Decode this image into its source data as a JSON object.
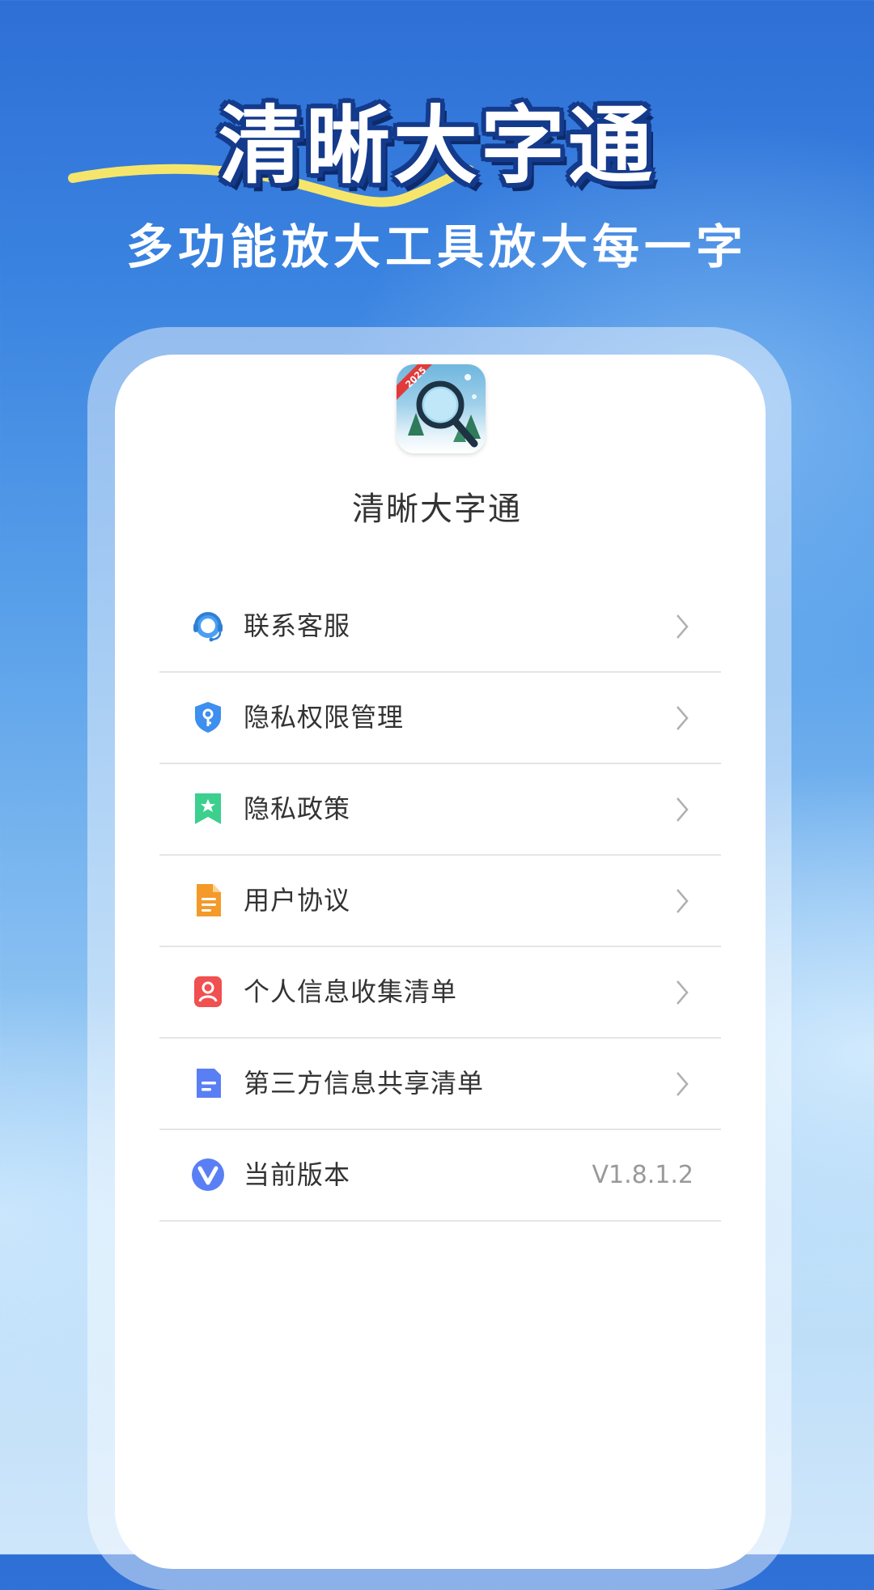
{
  "banner": {
    "title": "清晰大字通",
    "subtitle": "多功能放大工具放大每一字",
    "swoosh_color": "#f5e66b"
  },
  "app": {
    "icon_badge": "2025",
    "name": "清晰大字通"
  },
  "menu": {
    "items": [
      {
        "label": "联系客服",
        "icon": "headset-icon",
        "color": "#4a9ff0"
      },
      {
        "label": "隐私权限管理",
        "icon": "shield-key-icon",
        "color": "#3d8ff0"
      },
      {
        "label": "隐私政策",
        "icon": "bookmark-star-icon",
        "color": "#3ccf8e"
      },
      {
        "label": "用户协议",
        "icon": "document-icon",
        "color": "#f39a2a"
      },
      {
        "label": "个人信息收集清单",
        "icon": "person-card-icon",
        "color": "#f0504f"
      },
      {
        "label": "第三方信息共享清单",
        "icon": "file-lines-icon",
        "color": "#5a7ff5"
      }
    ],
    "version": {
      "label": "当前版本",
      "value": "V1.8.1.2",
      "icon": "v-logo-icon",
      "color": "#5a7ff5"
    }
  }
}
